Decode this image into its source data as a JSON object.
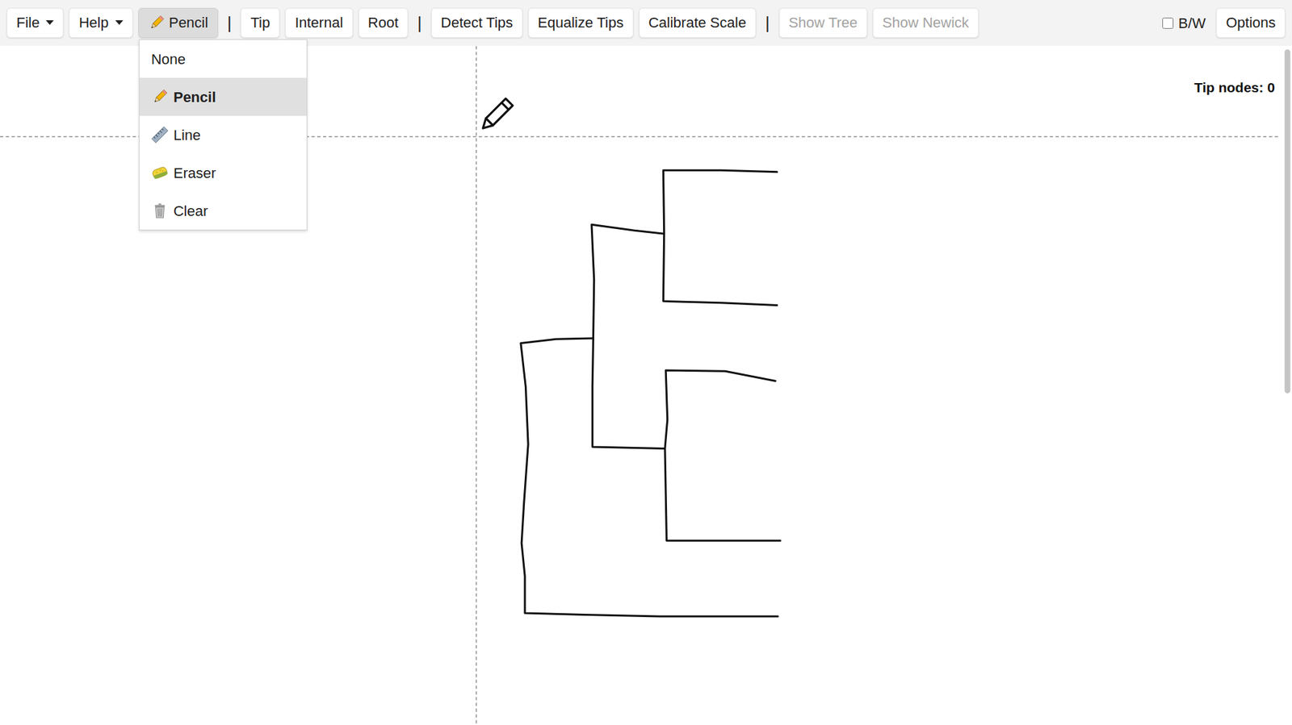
{
  "toolbar": [
    {
      "kind": "menu",
      "label": "File"
    },
    {
      "kind": "menu",
      "label": "Help"
    },
    {
      "kind": "tool",
      "label": "Pencil",
      "expanded": true
    },
    {
      "kind": "separator",
      "label": "|"
    },
    {
      "kind": "button",
      "label": "Tip",
      "disabled": false
    },
    {
      "kind": "button",
      "label": "Internal",
      "disabled": false
    },
    {
      "kind": "button",
      "label": "Root",
      "disabled": false
    },
    {
      "kind": "separator",
      "label": "|"
    },
    {
      "kind": "button",
      "label": "Detect Tips",
      "disabled": false
    },
    {
      "kind": "button",
      "label": "Equalize Tips",
      "disabled": false
    },
    {
      "kind": "button",
      "label": "Calibrate Scale",
      "disabled": false
    },
    {
      "kind": "separator",
      "label": "|"
    },
    {
      "kind": "button",
      "label": "Show Tree",
      "disabled": true
    },
    {
      "kind": "button",
      "label": "Show Newick",
      "disabled": true
    }
  ],
  "bw": {
    "label": "B/W",
    "checked": false
  },
  "options": {
    "label": "Options"
  },
  "tool_menu": [
    {
      "label": "None",
      "selected": false
    },
    {
      "label": "Pencil",
      "selected": true
    },
    {
      "label": "Line",
      "selected": false
    },
    {
      "label": "Eraser",
      "selected": false
    },
    {
      "label": "Clear",
      "selected": false
    }
  ],
  "canvas": {
    "tip_count": "Tip nodes: 0"
  }
}
